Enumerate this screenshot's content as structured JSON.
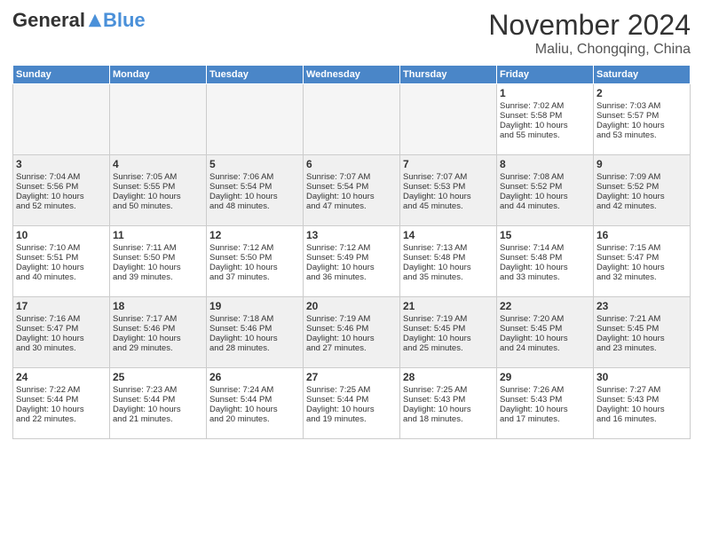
{
  "header": {
    "logo_general": "General",
    "logo_blue": "Blue",
    "month_title": "November 2024",
    "location": "Maliu, Chongqing, China"
  },
  "columns": [
    "Sunday",
    "Monday",
    "Tuesday",
    "Wednesday",
    "Thursday",
    "Friday",
    "Saturday"
  ],
  "weeks": [
    {
      "days": [
        {
          "num": "",
          "empty": true
        },
        {
          "num": "",
          "empty": true
        },
        {
          "num": "",
          "empty": true
        },
        {
          "num": "",
          "empty": true
        },
        {
          "num": "",
          "empty": true
        },
        {
          "num": "1",
          "lines": [
            "Sunrise: 7:02 AM",
            "Sunset: 5:58 PM",
            "Daylight: 10 hours",
            "and 55 minutes."
          ]
        },
        {
          "num": "2",
          "lines": [
            "Sunrise: 7:03 AM",
            "Sunset: 5:57 PM",
            "Daylight: 10 hours",
            "and 53 minutes."
          ]
        }
      ]
    },
    {
      "days": [
        {
          "num": "3",
          "lines": [
            "Sunrise: 7:04 AM",
            "Sunset: 5:56 PM",
            "Daylight: 10 hours",
            "and 52 minutes."
          ]
        },
        {
          "num": "4",
          "lines": [
            "Sunrise: 7:05 AM",
            "Sunset: 5:55 PM",
            "Daylight: 10 hours",
            "and 50 minutes."
          ]
        },
        {
          "num": "5",
          "lines": [
            "Sunrise: 7:06 AM",
            "Sunset: 5:54 PM",
            "Daylight: 10 hours",
            "and 48 minutes."
          ]
        },
        {
          "num": "6",
          "lines": [
            "Sunrise: 7:07 AM",
            "Sunset: 5:54 PM",
            "Daylight: 10 hours",
            "and 47 minutes."
          ]
        },
        {
          "num": "7",
          "lines": [
            "Sunrise: 7:07 AM",
            "Sunset: 5:53 PM",
            "Daylight: 10 hours",
            "and 45 minutes."
          ]
        },
        {
          "num": "8",
          "lines": [
            "Sunrise: 7:08 AM",
            "Sunset: 5:52 PM",
            "Daylight: 10 hours",
            "and 44 minutes."
          ]
        },
        {
          "num": "9",
          "lines": [
            "Sunrise: 7:09 AM",
            "Sunset: 5:52 PM",
            "Daylight: 10 hours",
            "and 42 minutes."
          ]
        }
      ]
    },
    {
      "days": [
        {
          "num": "10",
          "lines": [
            "Sunrise: 7:10 AM",
            "Sunset: 5:51 PM",
            "Daylight: 10 hours",
            "and 40 minutes."
          ]
        },
        {
          "num": "11",
          "lines": [
            "Sunrise: 7:11 AM",
            "Sunset: 5:50 PM",
            "Daylight: 10 hours",
            "and 39 minutes."
          ]
        },
        {
          "num": "12",
          "lines": [
            "Sunrise: 7:12 AM",
            "Sunset: 5:50 PM",
            "Daylight: 10 hours",
            "and 37 minutes."
          ]
        },
        {
          "num": "13",
          "lines": [
            "Sunrise: 7:12 AM",
            "Sunset: 5:49 PM",
            "Daylight: 10 hours",
            "and 36 minutes."
          ]
        },
        {
          "num": "14",
          "lines": [
            "Sunrise: 7:13 AM",
            "Sunset: 5:48 PM",
            "Daylight: 10 hours",
            "and 35 minutes."
          ]
        },
        {
          "num": "15",
          "lines": [
            "Sunrise: 7:14 AM",
            "Sunset: 5:48 PM",
            "Daylight: 10 hours",
            "and 33 minutes."
          ]
        },
        {
          "num": "16",
          "lines": [
            "Sunrise: 7:15 AM",
            "Sunset: 5:47 PM",
            "Daylight: 10 hours",
            "and 32 minutes."
          ]
        }
      ]
    },
    {
      "days": [
        {
          "num": "17",
          "lines": [
            "Sunrise: 7:16 AM",
            "Sunset: 5:47 PM",
            "Daylight: 10 hours",
            "and 30 minutes."
          ]
        },
        {
          "num": "18",
          "lines": [
            "Sunrise: 7:17 AM",
            "Sunset: 5:46 PM",
            "Daylight: 10 hours",
            "and 29 minutes."
          ]
        },
        {
          "num": "19",
          "lines": [
            "Sunrise: 7:18 AM",
            "Sunset: 5:46 PM",
            "Daylight: 10 hours",
            "and 28 minutes."
          ]
        },
        {
          "num": "20",
          "lines": [
            "Sunrise: 7:19 AM",
            "Sunset: 5:46 PM",
            "Daylight: 10 hours",
            "and 27 minutes."
          ]
        },
        {
          "num": "21",
          "lines": [
            "Sunrise: 7:19 AM",
            "Sunset: 5:45 PM",
            "Daylight: 10 hours",
            "and 25 minutes."
          ]
        },
        {
          "num": "22",
          "lines": [
            "Sunrise: 7:20 AM",
            "Sunset: 5:45 PM",
            "Daylight: 10 hours",
            "and 24 minutes."
          ]
        },
        {
          "num": "23",
          "lines": [
            "Sunrise: 7:21 AM",
            "Sunset: 5:45 PM",
            "Daylight: 10 hours",
            "and 23 minutes."
          ]
        }
      ]
    },
    {
      "days": [
        {
          "num": "24",
          "lines": [
            "Sunrise: 7:22 AM",
            "Sunset: 5:44 PM",
            "Daylight: 10 hours",
            "and 22 minutes."
          ]
        },
        {
          "num": "25",
          "lines": [
            "Sunrise: 7:23 AM",
            "Sunset: 5:44 PM",
            "Daylight: 10 hours",
            "and 21 minutes."
          ]
        },
        {
          "num": "26",
          "lines": [
            "Sunrise: 7:24 AM",
            "Sunset: 5:44 PM",
            "Daylight: 10 hours",
            "and 20 minutes."
          ]
        },
        {
          "num": "27",
          "lines": [
            "Sunrise: 7:25 AM",
            "Sunset: 5:44 PM",
            "Daylight: 10 hours",
            "and 19 minutes."
          ]
        },
        {
          "num": "28",
          "lines": [
            "Sunrise: 7:25 AM",
            "Sunset: 5:43 PM",
            "Daylight: 10 hours",
            "and 18 minutes."
          ]
        },
        {
          "num": "29",
          "lines": [
            "Sunrise: 7:26 AM",
            "Sunset: 5:43 PM",
            "Daylight: 10 hours",
            "and 17 minutes."
          ]
        },
        {
          "num": "30",
          "lines": [
            "Sunrise: 7:27 AM",
            "Sunset: 5:43 PM",
            "Daylight: 10 hours",
            "and 16 minutes."
          ]
        }
      ]
    }
  ]
}
